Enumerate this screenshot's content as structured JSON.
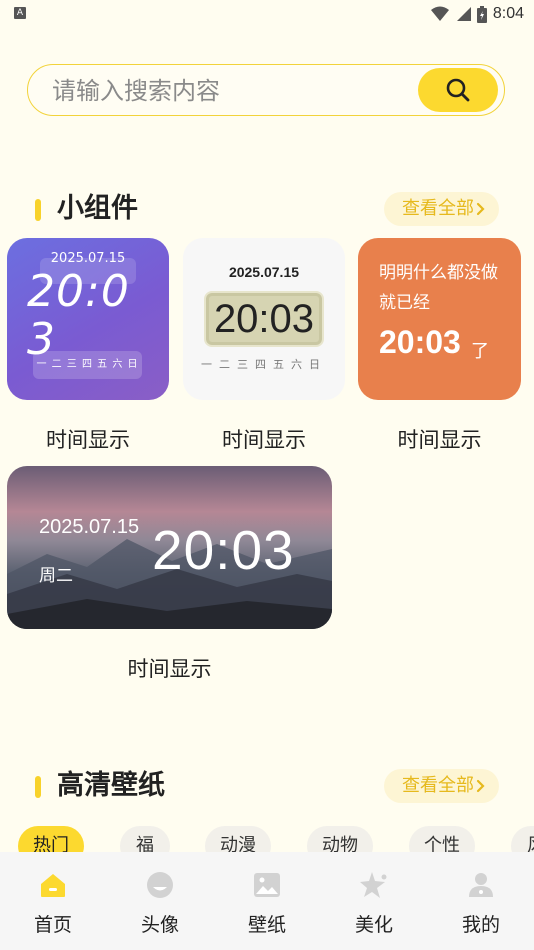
{
  "status_bar": {
    "time": "8:04",
    "left_icon": "A"
  },
  "search": {
    "placeholder": "请输入搜索内容",
    "value": ""
  },
  "widgets_section": {
    "title": "小组件",
    "view_all": "查看全部",
    "items": [
      {
        "label": "时间显示",
        "date": "2025.07.15",
        "time": "20:03",
        "weekdays": "一 二 三 四 五 六 日"
      },
      {
        "label": "时间显示",
        "date": "2025.07.15",
        "time": "20:03",
        "weekdays": "一二三四五六日"
      },
      {
        "label": "时间显示",
        "line1": "明明什么都没做",
        "line2": "就已经",
        "time": "20:03",
        "suffix": "了"
      },
      {
        "label": "时间显示",
        "date": "2025.07.15",
        "day": "周二",
        "time": "20:03"
      }
    ]
  },
  "wallpaper_section": {
    "title": "高清壁纸",
    "view_all": "查看全部",
    "tags": [
      "热门",
      "福",
      "动漫",
      "动物",
      "个性",
      "风"
    ]
  },
  "bottom_nav": {
    "items": [
      {
        "label": "首页",
        "icon": "home-icon",
        "active": true
      },
      {
        "label": "头像",
        "icon": "avatar-icon",
        "active": false
      },
      {
        "label": "壁纸",
        "icon": "image-icon",
        "active": false
      },
      {
        "label": "美化",
        "icon": "star-icon",
        "active": false
      },
      {
        "label": "我的",
        "icon": "user-icon",
        "active": false
      }
    ]
  },
  "colors": {
    "accent": "#fcd92f",
    "background": "#fffdf0",
    "orange_widget": "#e8804c",
    "purple_widget": "#6c6fe0"
  }
}
